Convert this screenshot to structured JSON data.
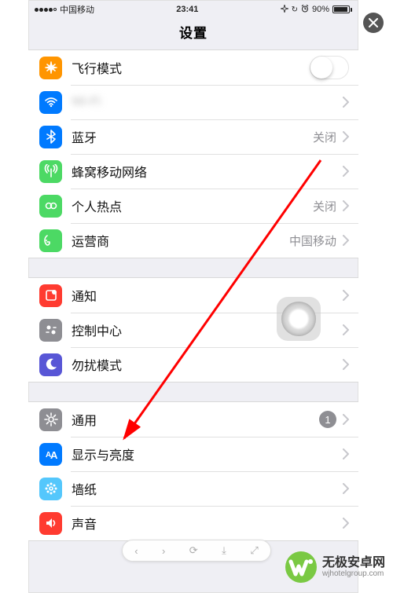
{
  "status_bar": {
    "carrier": "中国移动",
    "time": "23:41",
    "battery_pct": "90%"
  },
  "nav": {
    "title": "设置"
  },
  "groups": [
    {
      "rows": [
        {
          "icon": "airplane",
          "icon_bg": "#ff9500",
          "label": "飞行模式",
          "accessory": "switch",
          "switch_on": false
        },
        {
          "icon": "wifi",
          "icon_bg": "#007aff",
          "label": "Wi-Fi",
          "value": "",
          "accessory": "disclosure",
          "blurred": true
        },
        {
          "icon": "bluetooth",
          "icon_bg": "#007aff",
          "label": "蓝牙",
          "value": "关闭",
          "accessory": "disclosure"
        },
        {
          "icon": "cellular",
          "icon_bg": "#4cd964",
          "label": "蜂窝移动网络",
          "accessory": "disclosure"
        },
        {
          "icon": "hotspot",
          "icon_bg": "#4cd964",
          "label": "个人热点",
          "value": "关闭",
          "accessory": "disclosure"
        },
        {
          "icon": "carrier",
          "icon_bg": "#4cd964",
          "label": "运营商",
          "value": "中国移动",
          "accessory": "disclosure"
        }
      ]
    },
    {
      "rows": [
        {
          "icon": "notification",
          "icon_bg": "#ff3b30",
          "label": "通知",
          "accessory": "disclosure"
        },
        {
          "icon": "control",
          "icon_bg": "#8e8e93",
          "label": "控制中心",
          "accessory": "disclosure"
        },
        {
          "icon": "moon",
          "icon_bg": "#5856d6",
          "label": "勿扰模式",
          "accessory": "disclosure"
        }
      ]
    },
    {
      "rows": [
        {
          "icon": "gear",
          "icon_bg": "#8e8e93",
          "label": "通用",
          "badge": "1",
          "accessory": "disclosure"
        },
        {
          "icon": "display",
          "icon_bg": "#007aff",
          "label": "显示与亮度",
          "accessory": "disclosure"
        },
        {
          "icon": "wallpaper",
          "icon_bg": "#54c7fc",
          "label": "墙纸",
          "accessory": "disclosure"
        },
        {
          "icon": "sound",
          "icon_bg": "#ff3b30",
          "label": "声音",
          "accessory": "disclosure"
        }
      ]
    }
  ],
  "watermark": {
    "cn": "无极安卓网",
    "en": "wjhotelgroup.com"
  }
}
